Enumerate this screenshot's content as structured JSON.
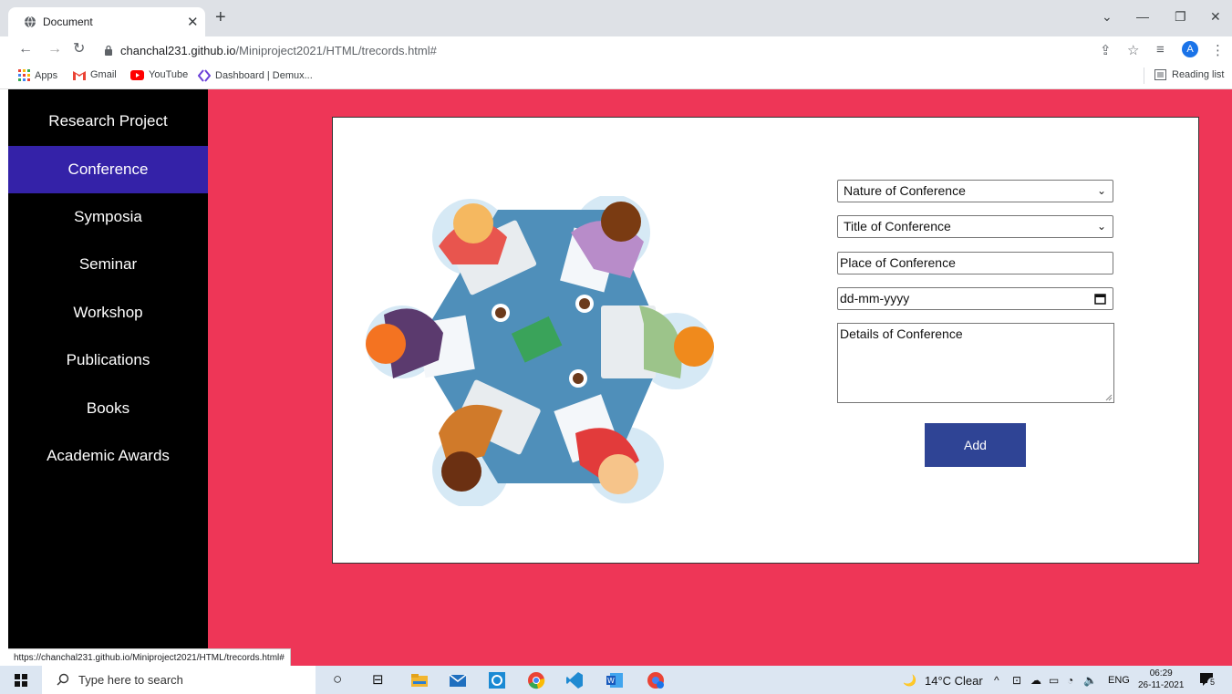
{
  "browser": {
    "tab_title": "Document",
    "new_tab": "+",
    "url_host": "chanchal231.github.io",
    "url_path": "/Miniproject2021/HTML/trecords.html#",
    "profile_initial": "A",
    "bookmarks": [
      {
        "label": "Apps"
      },
      {
        "label": "Gmail"
      },
      {
        "label": "YouTube"
      },
      {
        "label": "Dashboard | Demux..."
      }
    ],
    "reading_list": "Reading list",
    "status_url": "https://chanchal231.github.io/Miniproject2021/HTML/trecords.html#"
  },
  "sidebar": {
    "items": [
      {
        "label": "Research Project",
        "active": false
      },
      {
        "label": "Conference",
        "active": true
      },
      {
        "label": "Symposia",
        "active": false
      },
      {
        "label": "Seminar",
        "active": false
      },
      {
        "label": "Workshop",
        "active": false
      },
      {
        "label": "Publications",
        "active": false
      },
      {
        "label": "Books",
        "active": false
      },
      {
        "label": "Academic Awards",
        "active": false
      }
    ]
  },
  "form": {
    "nature_select": "Nature of Conference",
    "title_select": "Title of Conference",
    "place_input": "Place of Conference",
    "date_input": "dd-mm-yyyy",
    "details_textarea": "Details  of Conference",
    "add_label": "Add"
  },
  "taskbar": {
    "search_placeholder": "Type here to search",
    "weather": "14°C  Clear",
    "language": "ENG",
    "time": "06:29",
    "date": "26-11-2021",
    "notifications": "5"
  },
  "colors": {
    "page_bg": "#ee3657",
    "sidebar_bg": "#000000",
    "active_item": "#3422a8",
    "add_button": "#2f4495"
  }
}
